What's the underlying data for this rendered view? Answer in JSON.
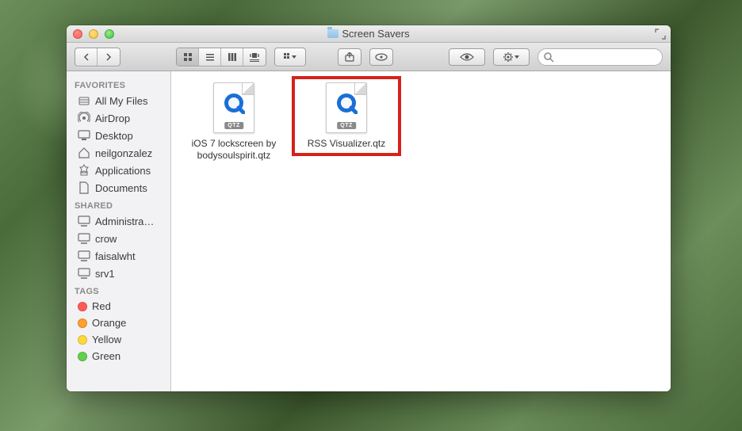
{
  "window": {
    "title": "Screen Savers"
  },
  "search": {
    "placeholder": ""
  },
  "sidebar": {
    "sections": [
      {
        "header": "Favorites",
        "items": [
          {
            "label": "All My Files",
            "icon": "all-my-files"
          },
          {
            "label": "AirDrop",
            "icon": "airdrop"
          },
          {
            "label": "Desktop",
            "icon": "desktop"
          },
          {
            "label": "neilgonzalez",
            "icon": "home"
          },
          {
            "label": "Applications",
            "icon": "applications"
          },
          {
            "label": "Documents",
            "icon": "documents"
          }
        ]
      },
      {
        "header": "Shared",
        "items": [
          {
            "label": "Administra…",
            "icon": "computer"
          },
          {
            "label": "crow",
            "icon": "computer"
          },
          {
            "label": "faisalwht",
            "icon": "computer"
          },
          {
            "label": "srv1",
            "icon": "computer"
          }
        ]
      },
      {
        "header": "Tags",
        "items": [
          {
            "label": "Red",
            "color": "#ff5b56"
          },
          {
            "label": "Orange",
            "color": "#ff9f2e"
          },
          {
            "label": "Yellow",
            "color": "#ffd93a"
          },
          {
            "label": "Green",
            "color": "#62d04f"
          }
        ]
      }
    ]
  },
  "files": [
    {
      "name": "iOS 7 lockscreen by bodysoulspirit.qtz",
      "badge": "QTZ",
      "highlighted": false
    },
    {
      "name": "RSS Visualizer.qtz",
      "badge": "QTZ",
      "highlighted": true
    }
  ]
}
